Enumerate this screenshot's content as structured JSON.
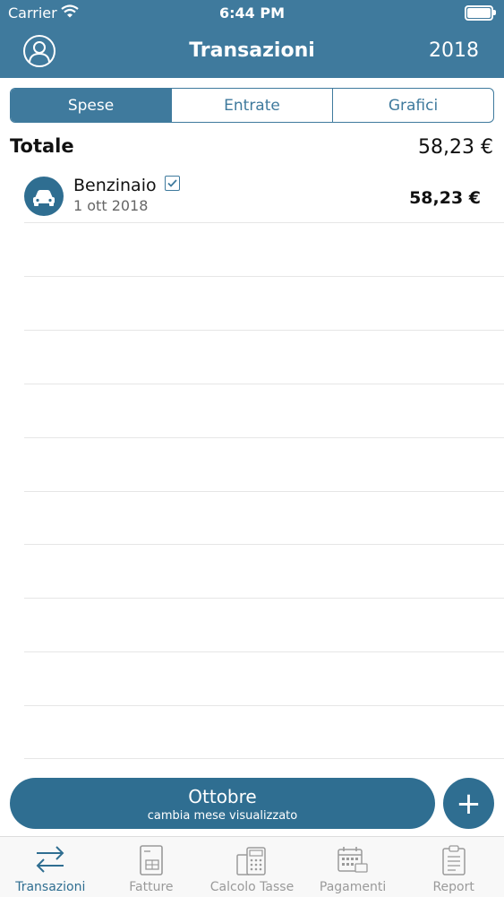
{
  "status_bar": {
    "carrier": "Carrier",
    "time": "6:44 PM"
  },
  "nav": {
    "title": "Transazioni",
    "year": "2018"
  },
  "segments": [
    {
      "label": "Spese",
      "active": true
    },
    {
      "label": "Entrate",
      "active": false
    },
    {
      "label": "Grafici",
      "active": false
    }
  ],
  "total": {
    "label": "Totale",
    "value": "58,23 €"
  },
  "transactions": [
    {
      "name": "Benzinaio",
      "date": "1 ott 2018",
      "amount": "58,23 €",
      "icon": "car-icon",
      "checked": true
    }
  ],
  "month_selector": {
    "month": "Ottobre",
    "subtitle": "cambia mese visualizzato"
  },
  "add_button": {
    "label": "+"
  },
  "tabs": [
    {
      "label": "Transazioni",
      "icon": "transfer-arrows-icon",
      "active": true
    },
    {
      "label": "Fatture",
      "icon": "invoice-icon",
      "active": false
    },
    {
      "label": "Calcolo Tasse",
      "icon": "calculator-icon",
      "active": false
    },
    {
      "label": "Pagamenti",
      "icon": "calendar-icon",
      "active": false
    },
    {
      "label": "Report",
      "icon": "clipboard-icon",
      "active": false
    }
  ],
  "colors": {
    "primary": "#3f7a9d",
    "primary_dark": "#2f6e91"
  }
}
